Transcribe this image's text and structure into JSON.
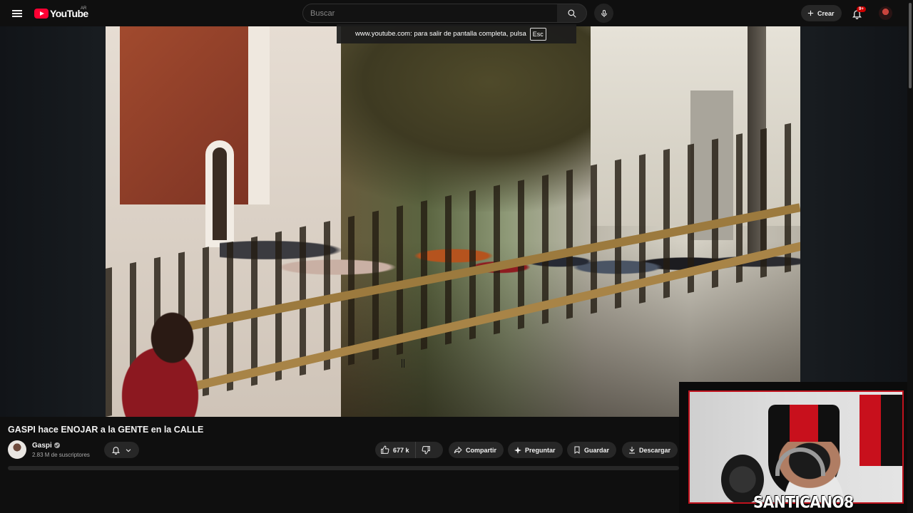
{
  "header": {
    "logo_text": "YouTube",
    "region": "AR",
    "search_placeholder": "Buscar",
    "create_label": "Crear",
    "notifications_badge": "9+"
  },
  "fullscreen_notice": {
    "text": "www.youtube.com: para salir de pantalla completa, pulsa",
    "key": "Esc"
  },
  "video": {
    "title": "GASPI hace ENOJAR a la GENTE en la CALLE",
    "channel": "Gaspi",
    "subscribers": "2.83 M de suscriptores",
    "likes": "677 k"
  },
  "actions": {
    "share": "Compartir",
    "ask": "Preguntar",
    "save": "Guardar",
    "download": "Descargar"
  },
  "overlay": {
    "streamer_name": "SANTICANO8"
  },
  "colors": {
    "brand_red": "#ff0033",
    "background": "#0f0f0f",
    "pill_bg": "#272727",
    "webcam_border": "#c0121d"
  },
  "icons": [
    "menu-icon",
    "search-icon",
    "mic-icon",
    "plus-icon",
    "bell-icon",
    "verified-icon",
    "bell-outline-icon",
    "chevron-down-icon",
    "thumbs-up-icon",
    "thumbs-down-icon",
    "share-icon",
    "sparkle-icon",
    "bookmark-icon",
    "download-icon"
  ]
}
